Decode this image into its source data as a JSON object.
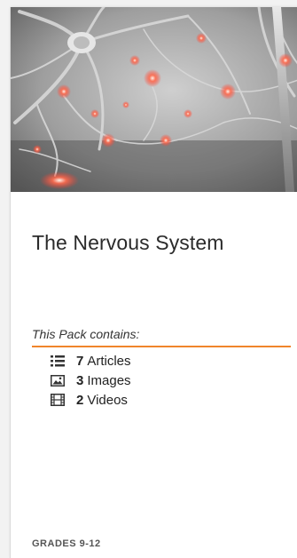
{
  "pack": {
    "title": "The Nervous System",
    "contains_label": "This Pack contains:",
    "accent_color": "#f0852b",
    "items": [
      {
        "icon": "list-icon",
        "count": "7",
        "label": "Articles"
      },
      {
        "icon": "image-icon",
        "count": "3",
        "label": "Images"
      },
      {
        "icon": "film-icon",
        "count": "2",
        "label": "Videos"
      }
    ],
    "grades": "GRADES 9-12"
  }
}
